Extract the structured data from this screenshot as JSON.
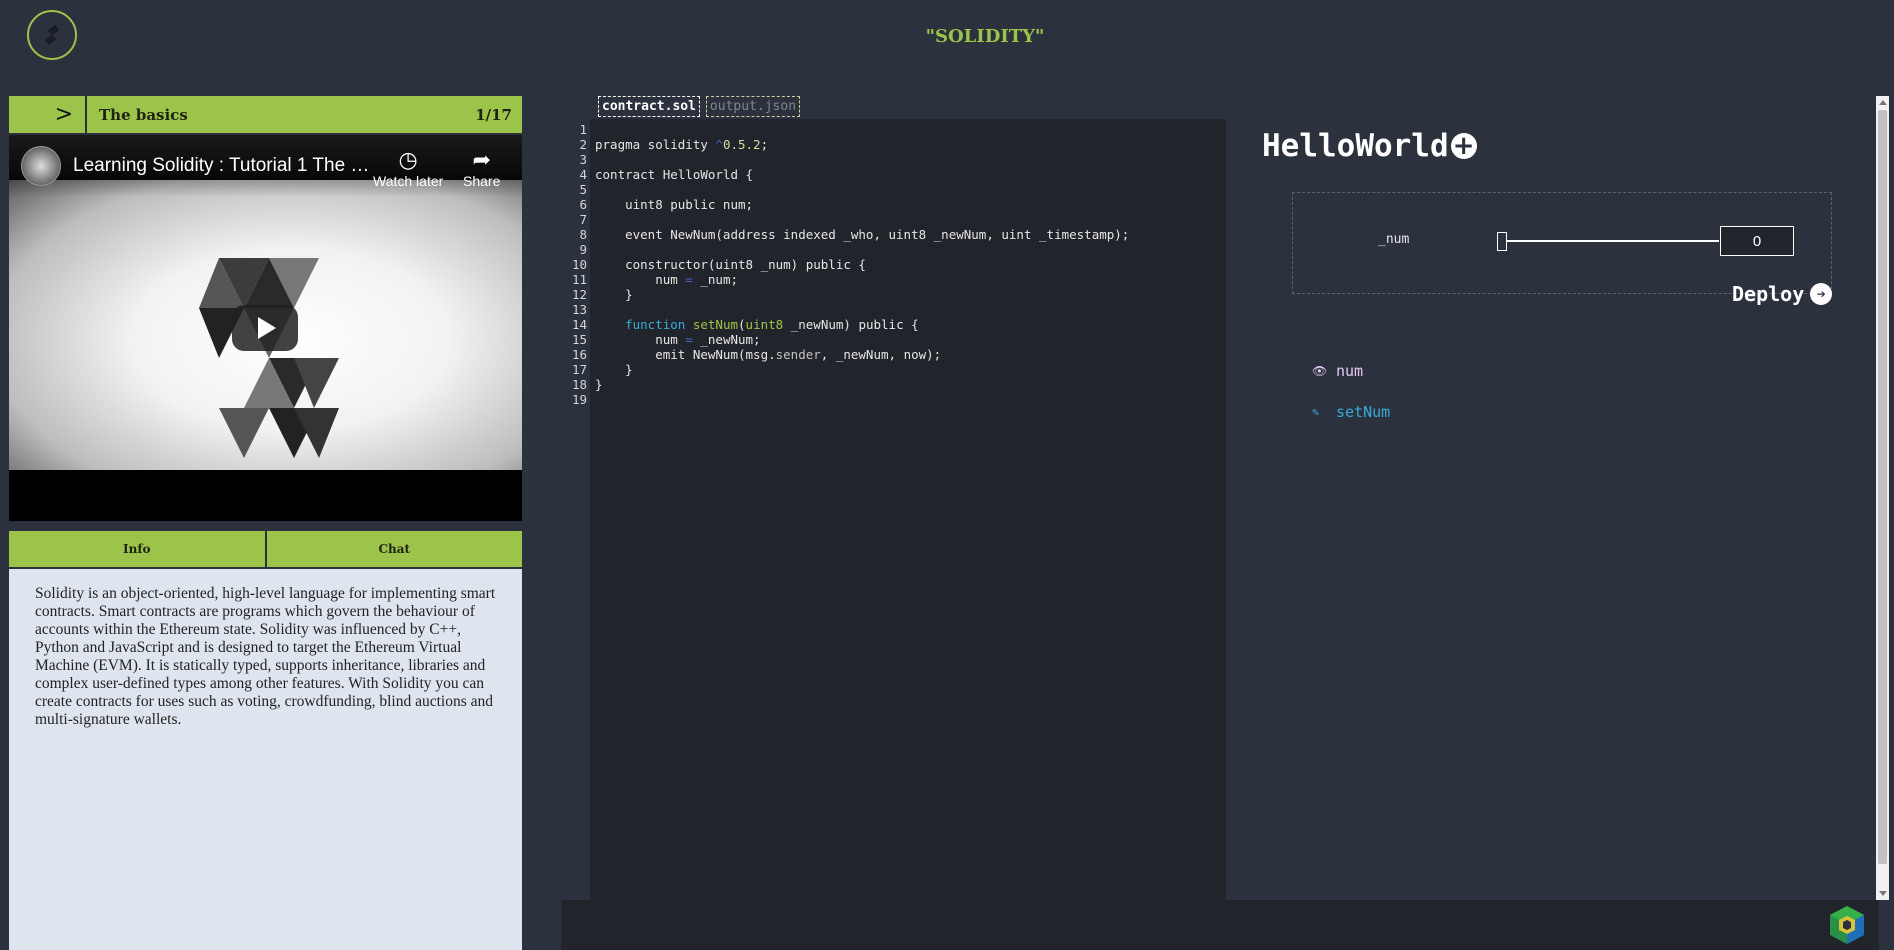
{
  "header": {
    "title": "\"SOLIDITY\"",
    "logo_icon": "solidity-logo-icon"
  },
  "lesson": {
    "toggle_label": ">",
    "title": "The basics",
    "counter": "1/17"
  },
  "video": {
    "title": "Learning Solidity : Tutorial 1 The B...",
    "watch_later_label": "Watch later",
    "share_label": "Share"
  },
  "tabs": {
    "info_label": "Info",
    "chat_label": "Chat"
  },
  "info": {
    "text": "Solidity is an object-oriented, high-level language for implementing smart contracts. Smart contracts are programs which govern the behaviour of accounts within the Ethereum state. Solidity was influenced by C++, Python and JavaScript and is designed to target the Ethereum Virtual Machine (EVM). It is statically typed, supports inheritance, libraries and complex user-defined types among other features. With Solidity you can create contracts for uses such as voting, crowdfunding, blind auctions and multi-signature wallets."
  },
  "editor": {
    "tabs": [
      "contract.sol",
      "output.json"
    ],
    "active_tab": "contract.sol",
    "lines": [
      "",
      "pragma solidity ^0.5.2;",
      "",
      "contract HelloWorld {",
      "",
      "    uint8 public num;",
      "",
      "    event NewNum(address indexed _who, uint8 _newNum, uint _timestamp);",
      "",
      "    constructor(uint8 _num) public {",
      "        num = _num;",
      "    }",
      "",
      "    function setNum(uint8 _newNum) public {",
      "        num = _newNum;",
      "        emit NewNum(msg.sender, _newNum, now);",
      "    }",
      "}",
      ""
    ]
  },
  "deploy": {
    "contract_name": "HelloWorld",
    "param_label": "_num",
    "param_value": "0",
    "slider_level": 0,
    "deploy_label": "Deploy",
    "functions": [
      {
        "name": "num",
        "kind": "view",
        "icon": "eye-icon"
      },
      {
        "name": "setNum",
        "kind": "transaction",
        "icon": "edit-icon"
      }
    ]
  },
  "colors": {
    "accent": "#9cc34a",
    "background": "#2b313d",
    "editor_bg": "#21252b",
    "info_bg": "#dee5ef",
    "keyword": "#3aa9d8"
  }
}
